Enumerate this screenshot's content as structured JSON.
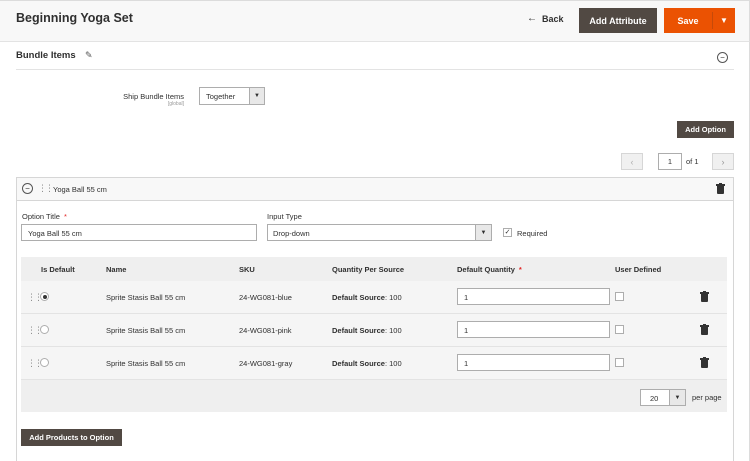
{
  "header": {
    "title": "Beginning Yoga Set",
    "back_label": "Back",
    "add_attribute_label": "Add Attribute",
    "save_label": "Save"
  },
  "section": {
    "title": "Bundle Items",
    "ship_label": "Ship Bundle Items",
    "ship_scope": "[global]",
    "ship_value": "Together",
    "add_option_label": "Add Option"
  },
  "pager": {
    "current": "1",
    "of_label": "of 1"
  },
  "option": {
    "name": "Yoga Ball 55 cm",
    "title_label": "Option Title",
    "title_value": "Yoga Ball 55 cm",
    "input_type_label": "Input Type",
    "input_type_value": "Drop-down",
    "required_label": "Required",
    "required_checked": true
  },
  "grid": {
    "headers": {
      "is_default": "Is Default",
      "name": "Name",
      "sku": "SKU",
      "qps": "Quantity Per Source",
      "default_qty": "Default Quantity",
      "user_defined": "User Defined"
    },
    "rows": [
      {
        "name": "Sprite Stasis Ball 55 cm",
        "sku": "24-WG081-blue",
        "source_label": "Default Source",
        "source_qty": ": 100",
        "default_qty": "1",
        "is_default": true,
        "user_defined": false
      },
      {
        "name": "Sprite Stasis Ball 55 cm",
        "sku": "24-WG081-pink",
        "source_label": "Default Source",
        "source_qty": ": 100",
        "default_qty": "1",
        "is_default": false,
        "user_defined": false
      },
      {
        "name": "Sprite Stasis Ball 55 cm",
        "sku": "24-WG081-gray",
        "source_label": "Default Source",
        "source_qty": ": 100",
        "default_qty": "1",
        "is_default": false,
        "user_defined": false
      }
    ],
    "per_page_value": "20",
    "per_page_label": "per page"
  },
  "add_products_label": "Add Products to Option",
  "colors": {
    "primary_button": "#eb5202",
    "secondary_button": "#514943",
    "required_star": "#e22626"
  },
  "icons": [
    "arrow-left-icon",
    "pencil-icon",
    "collapse-icon",
    "drag-handle-icon",
    "trash-icon",
    "checkmark-icon",
    "chevron-down-icon",
    "chevron-left-icon",
    "chevron-right-icon"
  ]
}
